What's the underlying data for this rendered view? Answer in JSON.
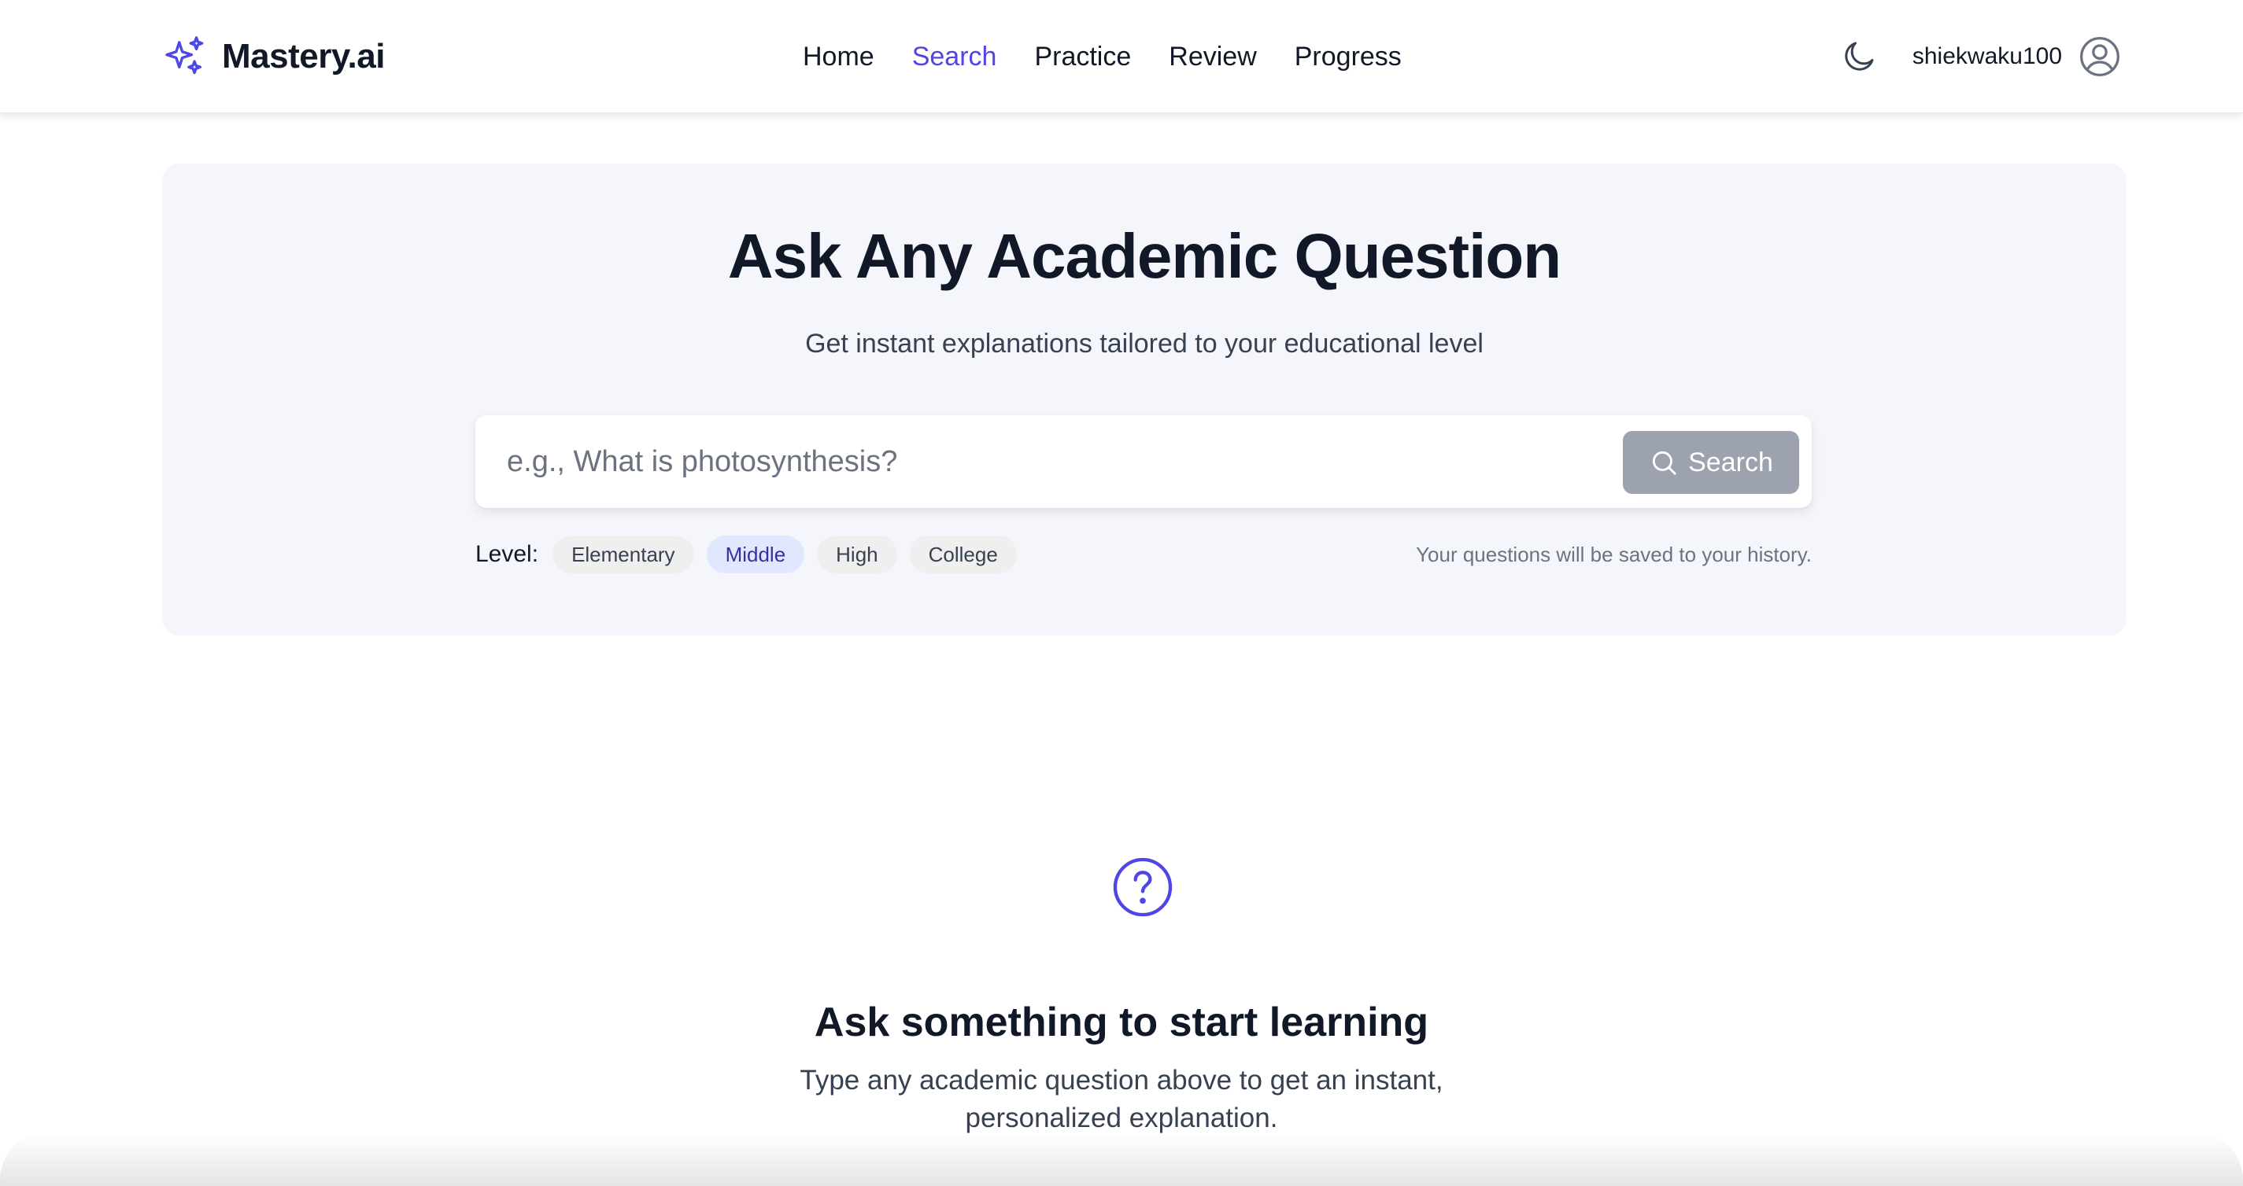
{
  "brand": {
    "name": "Mastery.ai",
    "icon": "sparkles-icon",
    "accent_color": "#4f46e5"
  },
  "nav": {
    "items": [
      {
        "label": "Home",
        "active": false
      },
      {
        "label": "Search",
        "active": true
      },
      {
        "label": "Practice",
        "active": false
      },
      {
        "label": "Review",
        "active": false
      },
      {
        "label": "Progress",
        "active": false
      }
    ]
  },
  "user": {
    "theme_toggle_icon": "moon-icon",
    "username": "shiekwaku100",
    "avatar_icon": "user-circle-icon"
  },
  "hero": {
    "title": "Ask Any Academic Question",
    "subtitle": "Get instant explanations tailored to your educational level",
    "search": {
      "value": "",
      "placeholder": "e.g., What is photosynthesis?",
      "button_label": "Search",
      "button_icon": "search-icon",
      "button_color": "#9ca3af"
    },
    "level": {
      "label": "Level:",
      "options": [
        "Elementary",
        "Middle",
        "High",
        "College"
      ],
      "selected": "Middle"
    },
    "history_note": "Your questions will be saved to your history."
  },
  "empty_state": {
    "icon": "question-circle-icon",
    "title": "Ask something to start learning",
    "description": "Type any academic question above to get an instant, personalized explanation."
  }
}
